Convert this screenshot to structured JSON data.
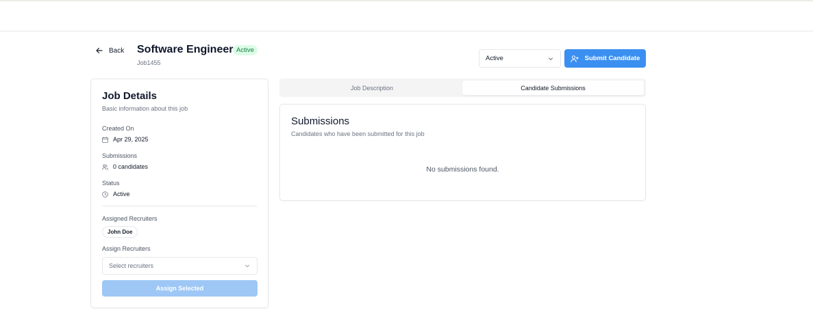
{
  "header": {
    "back_label": "Back",
    "job_title": "Software Engineer",
    "status_badge": "Active",
    "job_id": "Job1455",
    "status_select_value": "Active",
    "submit_label": "Submit Candidate"
  },
  "job_details": {
    "title": "Job Details",
    "subtitle": "Basic information about this job",
    "created_on_label": "Created On",
    "created_on_value": "Apr 29, 2025",
    "submissions_label": "Submissions",
    "submissions_value": "0 candidates",
    "status_label": "Status",
    "status_value": "Active",
    "assigned_recruiters_label": "Assigned Recruiters",
    "assigned_recruiters": [
      "John Doe"
    ],
    "assign_recruiters_label": "Assign Recruiters",
    "assign_placeholder": "Select recruiters",
    "assign_button": "Assign Selected"
  },
  "tabs": [
    {
      "label": "Job Description",
      "active": false
    },
    {
      "label": "Candidate Submissions",
      "active": true
    }
  ],
  "submissions": {
    "title": "Submissions",
    "subtitle": "Candidates who have been submitted for this job",
    "empty_message": "No submissions found."
  },
  "colors": {
    "primary": "#3b8ff0",
    "primary_disabled": "#9ec7f5",
    "active_badge_bg": "#dcfce7",
    "active_badge_text": "#15803d"
  }
}
